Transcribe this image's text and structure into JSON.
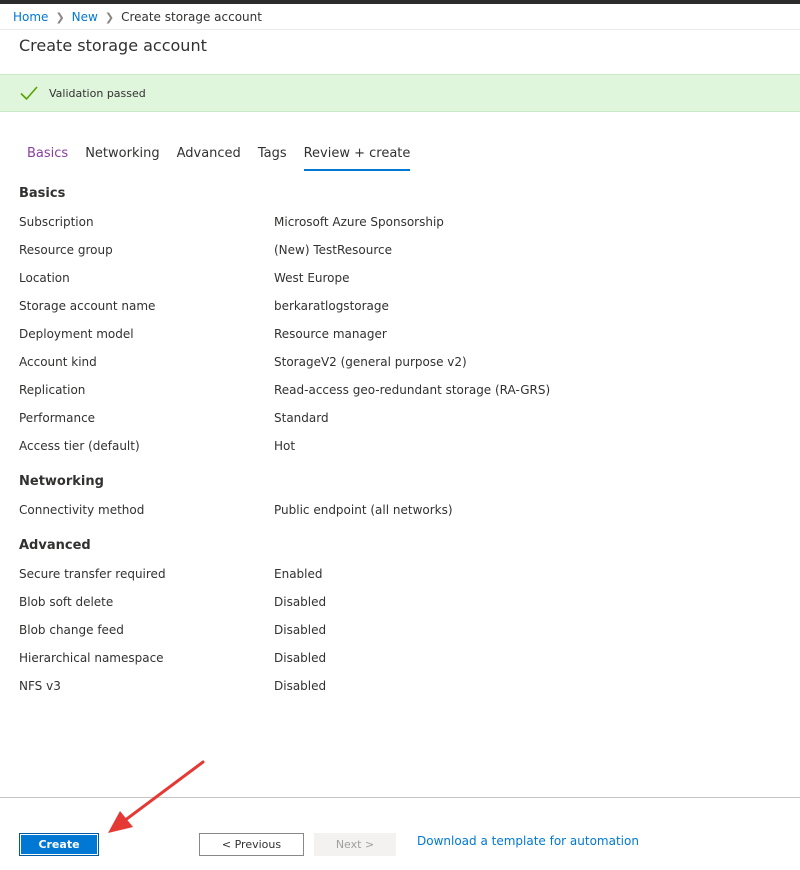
{
  "breadcrumb": {
    "items": [
      {
        "label": "Home"
      },
      {
        "label": "New"
      },
      {
        "label": "Create storage account"
      }
    ]
  },
  "page": {
    "title": "Create storage account"
  },
  "validation": {
    "message": "Validation passed",
    "color": "#dff6dd",
    "icon": "checkmark-icon"
  },
  "tabs": [
    {
      "label": "Basics",
      "state": "visited"
    },
    {
      "label": "Networking",
      "state": "default"
    },
    {
      "label": "Advanced",
      "state": "default"
    },
    {
      "label": "Tags",
      "state": "default"
    },
    {
      "label": "Review + create",
      "state": "active"
    }
  ],
  "summary": {
    "basics": {
      "heading": "Basics",
      "rows": [
        {
          "label": "Subscription",
          "value": "Microsoft Azure Sponsorship"
        },
        {
          "label": "Resource group",
          "value": "(New) TestResource"
        },
        {
          "label": "Location",
          "value": "West Europe"
        },
        {
          "label": "Storage account name",
          "value": "berkaratlogstorage"
        },
        {
          "label": "Deployment model",
          "value": "Resource manager"
        },
        {
          "label": "Account kind",
          "value": "StorageV2 (general purpose v2)"
        },
        {
          "label": "Replication",
          "value": "Read-access geo-redundant storage (RA-GRS)"
        },
        {
          "label": "Performance",
          "value": "Standard"
        },
        {
          "label": "Access tier (default)",
          "value": "Hot"
        }
      ]
    },
    "networking": {
      "heading": "Networking",
      "rows": [
        {
          "label": "Connectivity method",
          "value": "Public endpoint (all networks)"
        }
      ]
    },
    "advanced": {
      "heading": "Advanced",
      "rows": [
        {
          "label": "Secure transfer required",
          "value": "Enabled"
        },
        {
          "label": "Blob soft delete",
          "value": "Disabled"
        },
        {
          "label": "Blob change feed",
          "value": "Disabled"
        },
        {
          "label": "Hierarchical namespace",
          "value": "Disabled"
        },
        {
          "label": "NFS v3",
          "value": "Disabled"
        }
      ]
    }
  },
  "footer": {
    "create_label": "Create",
    "previous_label": "< Previous",
    "next_label": "Next >",
    "download_link": "Download a template for automation"
  },
  "colors": {
    "accent": "#0078d4",
    "visited_tab": "#8a3ea0",
    "annotation_arrow": "#e53935"
  }
}
